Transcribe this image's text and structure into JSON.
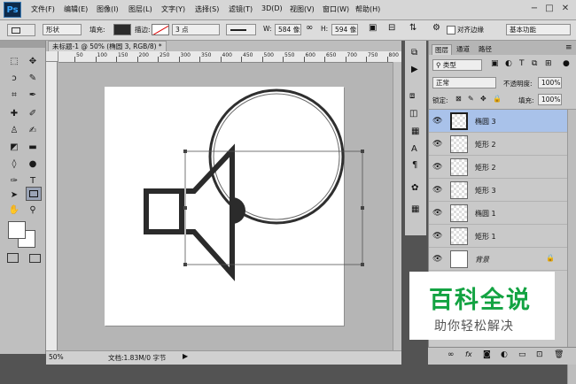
{
  "menubar": {
    "logo": "Ps",
    "items": [
      "文件(F)",
      "编辑(E)",
      "图像(I)",
      "图层(L)",
      "文字(Y)",
      "选择(S)",
      "滤镜(T)",
      "3D(D)",
      "视图(V)",
      "窗口(W)",
      "帮助(H)"
    ],
    "window_controls": [
      "−",
      "□",
      "✕"
    ]
  },
  "options": {
    "mode": "形状",
    "fill_label": "填充:",
    "stroke_label": "描边:",
    "stroke_width": "3 点",
    "w_label": "W:",
    "w_value": "584 像",
    "h_label": "H:",
    "h_value": "594 像",
    "align_edges": "对齐边缘",
    "workspace": "基本功能"
  },
  "document": {
    "tab_title": "未标题-1 @ 50% (椭圆 3, RGB/8) *",
    "ruler_ticks": [
      "50",
      "100",
      "150",
      "200",
      "250",
      "300",
      "350",
      "400",
      "450",
      "500",
      "550",
      "600",
      "650",
      "700",
      "750",
      "800"
    ],
    "zoom": "50%",
    "doc_info": "文档:1.83M/0 字节"
  },
  "layers_panel": {
    "tabs": [
      "图层",
      "通道",
      "路径"
    ],
    "filter_kind": "类型",
    "blend_mode": "正常",
    "opacity_label": "不透明度:",
    "opacity_value": "100%",
    "lock_label": "锁定:",
    "fill_label": "填充:",
    "fill_value": "100%",
    "layers": [
      {
        "name": "椭圆 3",
        "selected": true
      },
      {
        "name": "矩形 2",
        "selected": false
      },
      {
        "name": "矩形 2",
        "selected": false
      },
      {
        "name": "矩形 3",
        "selected": false
      },
      {
        "name": "椭圆 1",
        "selected": false
      },
      {
        "name": "矩形 1",
        "selected": false
      },
      {
        "name": "背景",
        "selected": false
      }
    ]
  },
  "watermark": {
    "title": "百科全说",
    "subtitle": "助你轻松解决"
  },
  "colors": {
    "accent_selected": "#a9c2ea",
    "watermark_green": "#13a342",
    "shape_dark": "#2b2b2b"
  }
}
